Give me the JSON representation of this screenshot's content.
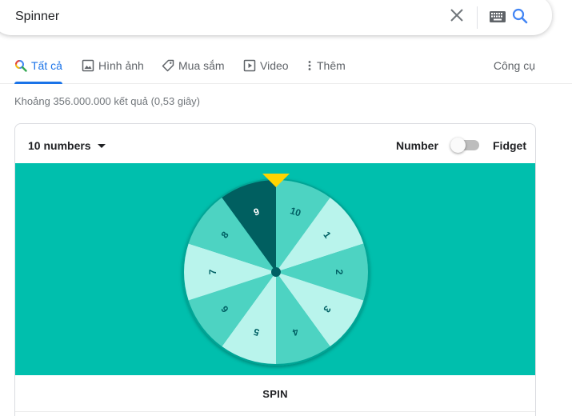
{
  "search": {
    "query": "Spinner"
  },
  "tabs": [
    {
      "label": "Tất cả",
      "icon": "search-color-icon",
      "active": true
    },
    {
      "label": "Hình ảnh",
      "icon": "image-icon"
    },
    {
      "label": "Mua sắm",
      "icon": "tag-icon"
    },
    {
      "label": "Video",
      "icon": "video-icon"
    },
    {
      "label": "Thêm",
      "icon": "more-vert-icon"
    }
  ],
  "tools_label": "Công cụ",
  "results_count": "Khoảng 356.000.000 kết quả (0,53 giây)",
  "spinner": {
    "count_label": "10 numbers",
    "mode_number": "Number",
    "mode_fidget": "Fidget",
    "spin_label": "SPIN",
    "numbers": [
      "10",
      "1",
      "2",
      "3",
      "4",
      "5",
      "6",
      "7",
      "8",
      "9"
    ],
    "selected": "9",
    "colors": {
      "background": "#00bfad",
      "light": "#b9f4ec",
      "mid": "#4dd3c2",
      "selected": "#005f60",
      "pointer": "#ffd400",
      "hub": "#006064"
    }
  }
}
